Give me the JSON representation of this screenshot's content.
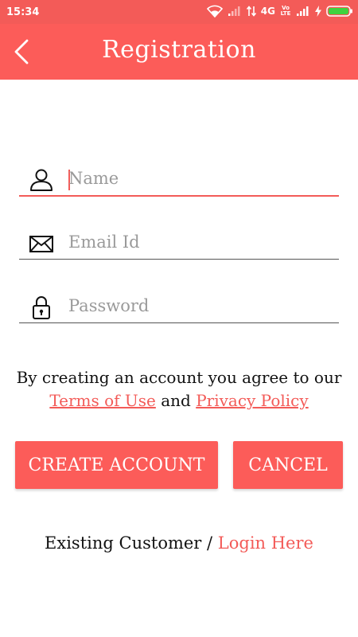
{
  "status_bar": {
    "time": "15:34",
    "network_label": "4G",
    "volte_label": "Vo LTE"
  },
  "toolbar": {
    "title": "Registration",
    "back_icon": "chevron-left-icon"
  },
  "form": {
    "name": {
      "placeholder": "Name",
      "value": "",
      "icon": "user-icon"
    },
    "email": {
      "placeholder": "Email Id",
      "value": "",
      "icon": "envelope-icon"
    },
    "password": {
      "placeholder": "Password",
      "value": "",
      "icon": "lock-icon"
    }
  },
  "terms": {
    "prefix": "By creating an account you agree to our",
    "terms_link": "Terms of Use",
    "conjunction": "and",
    "privacy_link": "Privacy Policy"
  },
  "actions": {
    "create_label": "CREATE ACCOUNT",
    "cancel_label": "CANCEL"
  },
  "footer": {
    "existing_text": "Existing Customer /",
    "login_link": "Login Here"
  },
  "colors": {
    "accent": "#fc5c59",
    "status_bar": "#f35b58",
    "battery": "#3fd23f"
  }
}
